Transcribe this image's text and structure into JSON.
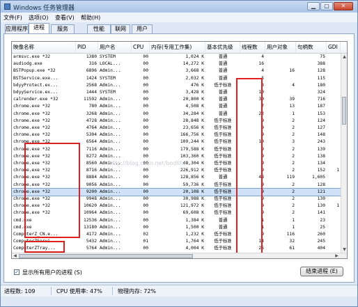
{
  "window": {
    "title": "Windows 任务管理器"
  },
  "menu": [
    "文件(F)",
    "选项(O)",
    "查看(V)",
    "帮助(H)"
  ],
  "tabs": [
    "应用程序",
    "进程",
    "服务",
    "性能",
    "联网",
    "用户"
  ],
  "active_tab": 1,
  "columns": [
    "映像名称",
    "PID",
    "用户名",
    "CPU",
    "内存(专用工作集)",
    "基本优先级",
    "线程数",
    "用户对象",
    "句柄数",
    "GDI"
  ],
  "rows": [
    [
      "armsvc.exe *32",
      "1380",
      "SYSTEM",
      "00",
      "1,024 K",
      "普通",
      "4",
      "",
      "75",
      ""
    ],
    [
      "audiodg.exe",
      "316",
      "LOCAL...",
      "00",
      "14,272 K",
      "普通",
      "16",
      "",
      "388",
      ""
    ],
    [
      "BSTPopup.exe *32",
      "6896",
      "Admin...",
      "00",
      "3,668 K",
      "普通",
      "4",
      "16",
      "128",
      ""
    ],
    [
      "BSTService.exe...",
      "1424",
      "SYSTEM",
      "00",
      "2,032 K",
      "普通",
      "5",
      "",
      "115",
      ""
    ],
    [
      "bdyyProtect.ex...",
      "2568",
      "Admin...",
      "00",
      "476 K",
      "低于标准",
      "3",
      "4",
      "180",
      ""
    ],
    [
      "bdyyService.ex...",
      "1444",
      "SYSTEM",
      "00",
      "3,428 K",
      "普通",
      "10",
      "",
      "324",
      ""
    ],
    [
      "calrender.exe *32",
      "11592",
      "Admin...",
      "00",
      "20,800 K",
      "普通",
      "30",
      "39",
      "716",
      ""
    ],
    [
      "chrome.exe *32",
      "780",
      "Admin...",
      "00",
      "4,508 K",
      "普通",
      "7",
      "13",
      "187",
      ""
    ],
    [
      "chrome.exe *32",
      "3268",
      "Admin...",
      "00",
      "34,284 K",
      "普通",
      "22",
      "1",
      "153",
      ""
    ],
    [
      "chrome.exe *32",
      "4728",
      "Admin...",
      "00",
      "28,848 K",
      "低于标准",
      "9",
      "2",
      "124",
      ""
    ],
    [
      "chrome.exe *32",
      "4764",
      "Admin...",
      "00",
      "23,656 K",
      "低于标准",
      "9",
      "2",
      "127",
      ""
    ],
    [
      "chrome.exe *32",
      "5304",
      "Admin...",
      "00",
      "166,756 K",
      "低于标准",
      "9",
      "2",
      "148",
      ""
    ],
    [
      "chrome.exe *32",
      "6564",
      "Admin...",
      "00",
      "109,244 K",
      "低于标准",
      "10",
      "3",
      "243",
      ""
    ],
    [
      "chrome.exe *32",
      "7116",
      "Admin...",
      "00",
      "179,588 K",
      "低于标准",
      "9",
      "2",
      "139",
      ""
    ],
    [
      "chrome.exe *32",
      "8272",
      "Admin...",
      "00",
      "103,360 K",
      "低于标准",
      "9",
      "2",
      "138",
      ""
    ],
    [
      "chrome.exe *32",
      "8560",
      "Admin...",
      "00",
      "48,304 K",
      "低于标准",
      "9",
      "2",
      "134",
      ""
    ],
    [
      "chrome.exe *32",
      "8716",
      "Admin...",
      "00",
      "226,912 K",
      "低于标准",
      "9",
      "2",
      "152",
      "1"
    ],
    [
      "chrome.exe *32",
      "8884",
      "Admin...",
      "00",
      "128,856 K",
      "普通",
      "48",
      "119",
      "1,605",
      ""
    ],
    [
      "chrome.exe *32",
      "9056",
      "Admin...",
      "00",
      "59,736 K",
      "低于标准",
      "9",
      "2",
      "128",
      ""
    ],
    [
      "chrome.exe *32",
      "9200",
      "Admin...",
      "00",
      "20,108 K",
      "低于标准",
      "9",
      "2",
      "121",
      ""
    ],
    [
      "chrome.exe *32",
      "9948",
      "Admin...",
      "00",
      "30,988 K",
      "低于标准",
      "9",
      "2",
      "130",
      ""
    ],
    [
      "chrome.exe *32",
      "10620",
      "Admin...",
      "00",
      "121,972 K",
      "低于标准",
      "9",
      "2",
      "130",
      "1"
    ],
    [
      "chrome.exe *32",
      "10964",
      "Admin...",
      "00",
      "69,608 K",
      "低于标准",
      "9",
      "2",
      "141",
      ""
    ],
    [
      "cmd.exe",
      "12536",
      "Admin...",
      "00",
      "1,384 K",
      "普通",
      "1",
      "1",
      "23",
      ""
    ],
    [
      "cmd.exe",
      "13180",
      "Admin...",
      "00",
      "1,500 K",
      "普通",
      "1",
      "1",
      "25",
      ""
    ],
    [
      "ComputerZ_CN.e...",
      "4172",
      "Admin...",
      "02",
      "1,232 K",
      "低于标准",
      "9",
      "116",
      "260",
      ""
    ],
    [
      "ComputerZServi...",
      "5432",
      "Admin...",
      "01",
      "1,764 K",
      "低于标准",
      "14",
      "32",
      "245",
      ""
    ],
    [
      "ComputerZTray...",
      "5764",
      "Admin...",
      "00",
      "4,004 K",
      "低于标准",
      "25",
      "61",
      "404",
      ""
    ]
  ],
  "selected_row": 19,
  "watermark": "http://blog.csdn.net/bodlifu",
  "show_all_label": "显示所有用户的进程 (S)",
  "show_all_checked": true,
  "end_process_label": "结束进程 (E)",
  "status": {
    "processes": "进程数: 109",
    "cpu": "CPU 使用率: 47%",
    "memory": "物理内存: 72%"
  }
}
